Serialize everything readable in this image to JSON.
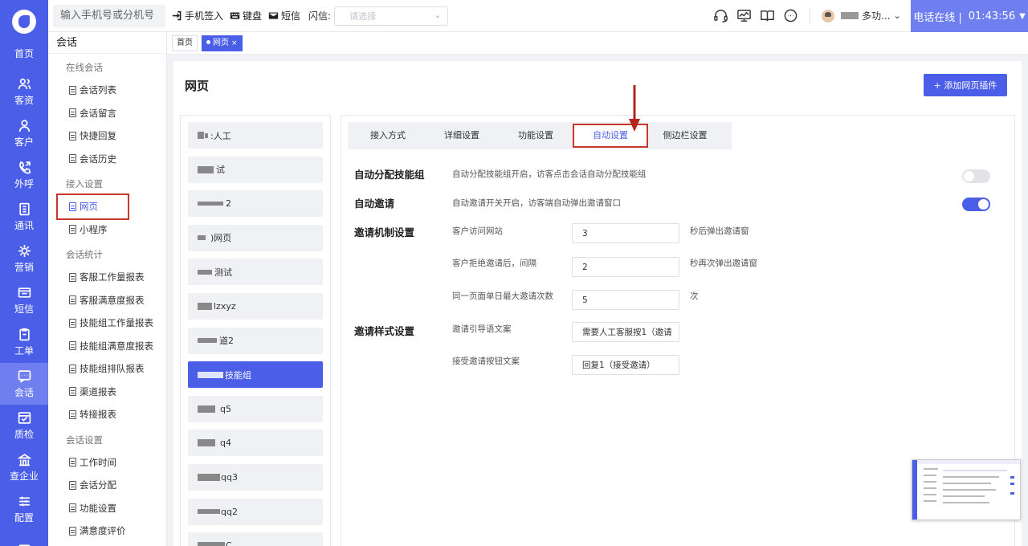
{
  "rail": {
    "items": [
      {
        "label": "首页",
        "icon": "home-icon"
      },
      {
        "label": "客资",
        "icon": "people-icon"
      },
      {
        "label": "客户",
        "icon": "person-icon"
      },
      {
        "label": "外呼",
        "icon": "call-out-icon"
      },
      {
        "label": "通讯",
        "icon": "address-book-icon"
      },
      {
        "label": "营销",
        "icon": "marketing-icon"
      },
      {
        "label": "短信",
        "icon": "sms-icon"
      },
      {
        "label": "工单",
        "icon": "clipboard-icon"
      },
      {
        "label": "会话",
        "icon": "chat-icon",
        "active": true
      },
      {
        "label": "质检",
        "icon": "inspect-icon"
      },
      {
        "label": "查企业",
        "icon": "building-icon"
      },
      {
        "label": "配置",
        "icon": "sliders-icon"
      }
    ]
  },
  "topbar": {
    "phone_placeholder": "输入手机号或分机号",
    "checkin": "手机签入",
    "keyboard": "键盘",
    "sms": "短信",
    "flash_label": "闪信:",
    "flash_placeholder": "请选择",
    "user_name_suffix": "多功...",
    "status": "电话在线 |",
    "clock": "01:43:56"
  },
  "sidebar": {
    "title": "会话",
    "groups": [
      {
        "title": "在线会话",
        "items": [
          "会话列表",
          "会话留言",
          "快捷回复",
          "会话历史"
        ]
      },
      {
        "title": "接入设置",
        "items": [
          "网页",
          "小程序"
        ]
      },
      {
        "title": "会话统计",
        "items": [
          "客服工作量报表",
          "客服满意度报表",
          "技能组工作量报表",
          "技能组满意度报表",
          "技能组排队报表",
          "渠道报表",
          "转接报表"
        ]
      },
      {
        "title": "会话设置",
        "items": [
          "工作时间",
          "会话分配",
          "功能设置",
          "满意度评价"
        ]
      }
    ],
    "active_item": "网页"
  },
  "page_tabs": [
    {
      "label": "首页",
      "active": false
    },
    {
      "label": "网页",
      "active": true,
      "close": "×"
    }
  ],
  "main": {
    "title": "网页",
    "add_button": "+ 添加网页插件",
    "plugins": [
      {
        "label": ":人工"
      },
      {
        "label": "试"
      },
      {
        "label": "2"
      },
      {
        "label": ")网页"
      },
      {
        "label": "测试"
      },
      {
        "label": "lzxyz"
      },
      {
        "label": "道2"
      },
      {
        "label": "技能组",
        "active": true
      },
      {
        "label": "q5"
      },
      {
        "label": "q4"
      },
      {
        "label": "qq3"
      },
      {
        "label": "qq2"
      },
      {
        "label": "C"
      }
    ],
    "tabs": [
      "接入方式",
      "详细设置",
      "功能设置",
      "自动设置",
      "侧边栏设置"
    ],
    "active_tab": "自动设置",
    "settings": {
      "auto_assign": {
        "label": "自动分配技能组",
        "desc": "自动分配技能组开启，访客点击会话自动分配技能组",
        "enabled": false
      },
      "auto_invite": {
        "label": "自动邀请",
        "desc": "自动邀请开关开启，访客端自动弹出邀请窗口",
        "enabled": true
      },
      "mechanism": {
        "label": "邀请机制设置",
        "fields": [
          {
            "label": "客户访问网站",
            "value": "3",
            "suffix": "秒后弹出邀请窗"
          },
          {
            "label": "客户拒绝邀请后，间隔",
            "value": "2",
            "suffix": "秒再次弹出邀请窗"
          },
          {
            "label": "同一页面单日最大邀请次数",
            "value": "5",
            "suffix": "次"
          }
        ]
      },
      "style": {
        "label": "邀请样式设置",
        "fields": [
          {
            "label": "邀请引导语文案",
            "value": "需要人工客服按1（邀请"
          },
          {
            "label": "接受邀请按钮文案",
            "value": "回复1（接受邀请）"
          }
        ]
      }
    }
  },
  "colors": {
    "primary": "#4a5ee8",
    "highlight": "#c9362e",
    "arrow": "#b3261e"
  }
}
